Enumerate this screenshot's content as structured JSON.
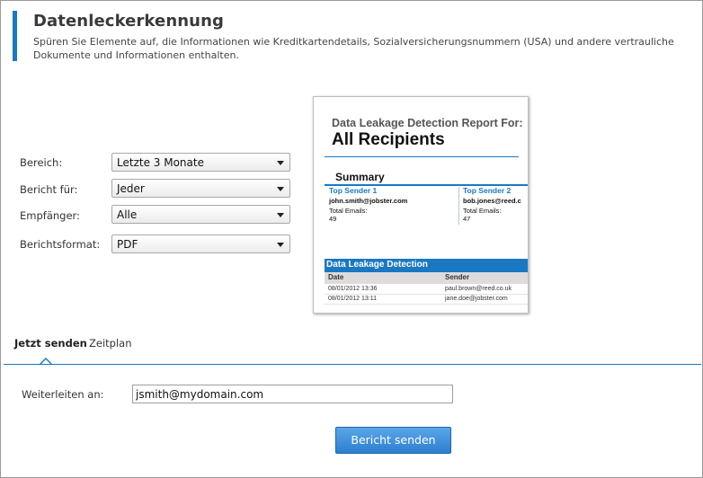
{
  "header": {
    "title": "Datenleckerkennung",
    "description": "Spüren Sie Elemente auf, die Informationen wie Kreditkartendetails, Sozialversicherungsnummern (USA) und andere vertrauliche Dokumente und Informationen enthalten."
  },
  "form": {
    "range": {
      "label": "Bereich:",
      "value": "Letzte 3 Monate"
    },
    "report_for": {
      "label": "Bericht für:",
      "value": "Jeder"
    },
    "recipient": {
      "label": "Empfänger:",
      "value": "Alle"
    },
    "format": {
      "label": "Berichtsformat:",
      "value": "PDF"
    }
  },
  "preview": {
    "subtitle": "Data Leakage Detection Report For:",
    "title": "All Recipients",
    "summary": "Summary",
    "cards": [
      {
        "heading": "Top Sender 1",
        "email": "john.smith@jobster.com",
        "total_label": "Total Emails:",
        "total": "49"
      },
      {
        "heading": "Top Sender 2",
        "email": "bob.jones@reed.c",
        "total_label": "Total Emails:",
        "total": "47"
      }
    ],
    "section": "Data Leakage Detection",
    "columns": [
      "Date",
      "Sender"
    ],
    "rows": [
      [
        "08/01/2012 13:36",
        "paul.brown@reed.co.uk"
      ],
      [
        "08/01/2012 13:11",
        "jane.doe@jobster.com"
      ]
    ]
  },
  "tabs": [
    {
      "label": "Jetzt senden",
      "active": true
    },
    {
      "label": "Zeitplan",
      "active": false
    }
  ],
  "forward": {
    "label": "Weiterleiten an:",
    "value": "jsmith@mydomain.com"
  },
  "send_button": "Bericht senden",
  "colors": {
    "accent": "#1a78c2",
    "button": "#3a8ad8"
  }
}
